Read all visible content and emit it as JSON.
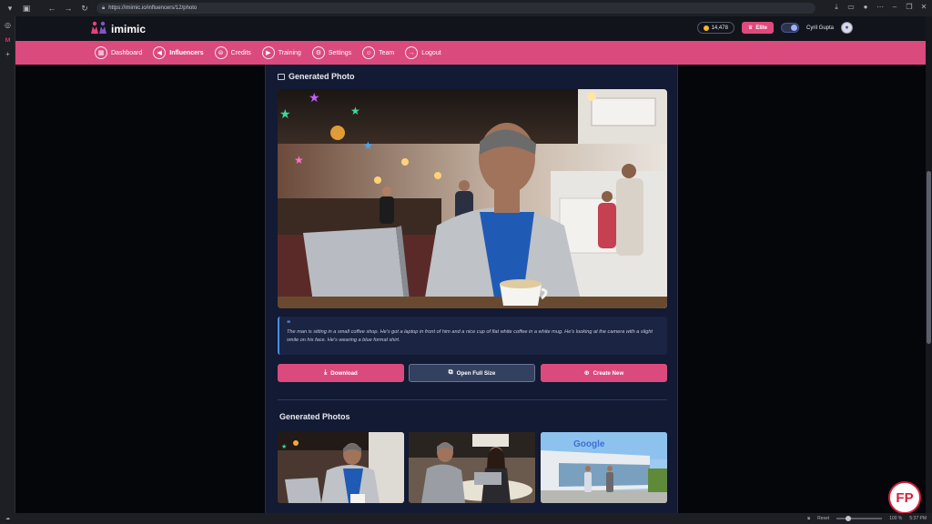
{
  "browser": {
    "url": "https://imimic.io/influencers/12/photo",
    "status_zoom": "100 %",
    "status_reset": "Reset",
    "status_time": "5:37 PM"
  },
  "header": {
    "brand": "imimic",
    "credits": "14,478",
    "plan": "Elite",
    "user_name": "Cyril Gupta"
  },
  "nav": {
    "items": [
      {
        "label": "Dashboard",
        "icon": "grid-icon"
      },
      {
        "label": "Influencers",
        "icon": "megaphone-icon"
      },
      {
        "label": "Credits",
        "icon": "coins-icon"
      },
      {
        "label": "Training",
        "icon": "video-icon"
      },
      {
        "label": "Settings",
        "icon": "gear-icon"
      },
      {
        "label": "Team",
        "icon": "team-icon"
      },
      {
        "label": "Logout",
        "icon": "logout-icon"
      }
    ],
    "active_index": 1
  },
  "main": {
    "section_title": "Generated Photo",
    "caption": "The man is sitting in a small coffee shop. He's got a laptop in front of him and a nice cup of flat white coffee in a white mug. He's looking at the camera with a slight smile on his face. He's wearing a blue formal shirt.",
    "buttons": {
      "download": "Download",
      "open_full": "Open Full Size",
      "create_new": "Create New"
    },
    "gallery_title": "Generated Photos",
    "gallery_brand_sign": "Google"
  },
  "colors": {
    "accent": "#db4a7c",
    "card_bg": "#131a33",
    "page_bg": "#0b0d14"
  }
}
